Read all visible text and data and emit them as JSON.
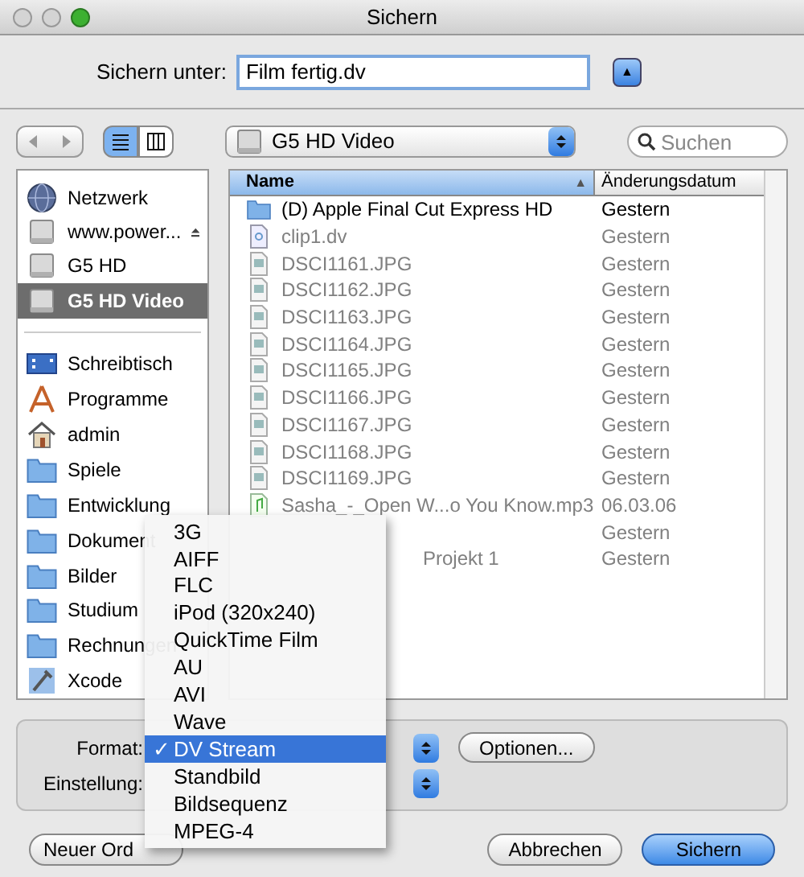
{
  "window": {
    "title": "Sichern"
  },
  "save_as": {
    "label": "Sichern unter:",
    "value": "Film fertig.dv",
    "expand_symbol": "▲"
  },
  "location": {
    "value": "G5 HD Video"
  },
  "search": {
    "placeholder": "Suchen"
  },
  "view_mode": {
    "list_selected": true
  },
  "sidebar": {
    "devices": [
      {
        "label": "Netzwerk",
        "kind": "network",
        "selected": false,
        "eject": false
      },
      {
        "label": "www.power...",
        "kind": "disk",
        "selected": false,
        "eject": true
      },
      {
        "label": "G5 HD",
        "kind": "disk",
        "selected": false,
        "eject": false
      },
      {
        "label": "G5 HD Video",
        "kind": "disk",
        "selected": true,
        "eject": false
      }
    ],
    "places": [
      {
        "label": "Schreibtisch",
        "kind": "desktop"
      },
      {
        "label": "Programme",
        "kind": "apps"
      },
      {
        "label": "admin",
        "kind": "home"
      },
      {
        "label": "Spiele",
        "kind": "folder"
      },
      {
        "label": "Entwicklung",
        "kind": "folder"
      },
      {
        "label": "Dokument",
        "kind": "folder"
      },
      {
        "label": "Bilder",
        "kind": "folder"
      },
      {
        "label": "Studium",
        "kind": "folder"
      },
      {
        "label": "Rechnungen",
        "kind": "folder"
      },
      {
        "label": "Xcode",
        "kind": "xcode"
      }
    ]
  },
  "table": {
    "columns": [
      {
        "label": "Name",
        "sort_symbol": "▲"
      },
      {
        "label": "Änderungsdatum"
      }
    ],
    "rows": [
      {
        "name": "(D) Apple Final Cut Express HD",
        "date": "Gestern",
        "kind": "folder",
        "disabled": false
      },
      {
        "name": "clip1.dv",
        "date": "Gestern",
        "kind": "movie",
        "disabled": true
      },
      {
        "name": "DSCI1161.JPG",
        "date": "Gestern",
        "kind": "image",
        "disabled": true
      },
      {
        "name": "DSCI1162.JPG",
        "date": "Gestern",
        "kind": "image",
        "disabled": true
      },
      {
        "name": "DSCI1163.JPG",
        "date": "Gestern",
        "kind": "image",
        "disabled": true
      },
      {
        "name": "DSCI1164.JPG",
        "date": "Gestern",
        "kind": "image",
        "disabled": true
      },
      {
        "name": "DSCI1165.JPG",
        "date": "Gestern",
        "kind": "image",
        "disabled": true
      },
      {
        "name": "DSCI1166.JPG",
        "date": "Gestern",
        "kind": "image",
        "disabled": true
      },
      {
        "name": "DSCI1167.JPG",
        "date": "Gestern",
        "kind": "image",
        "disabled": true
      },
      {
        "name": "DSCI1168.JPG",
        "date": "Gestern",
        "kind": "image",
        "disabled": true
      },
      {
        "name": "DSCI1169.JPG",
        "date": "Gestern",
        "kind": "image",
        "disabled": true
      },
      {
        "name": "Sasha_-_Open W...o You Know.mp3",
        "date": "06.03.06",
        "kind": "audio",
        "disabled": true
      },
      {
        "date": "Gestern",
        "kind": "hidden",
        "disabled": true
      },
      {
        "name": "Projekt 1",
        "date": "Gestern",
        "kind": "hidden",
        "disabled": true
      }
    ]
  },
  "format": {
    "label": "Format:",
    "options_button": "Optionen..."
  },
  "setting": {
    "label": "Einstellung:"
  },
  "format_menu": [
    {
      "label": "3G",
      "selected": false
    },
    {
      "label": "AIFF",
      "selected": false
    },
    {
      "label": "FLC",
      "selected": false
    },
    {
      "label": "iPod (320x240)",
      "selected": false
    },
    {
      "label": "QuickTime Film",
      "selected": false
    },
    {
      "label": "AU",
      "selected": false
    },
    {
      "label": "AVI",
      "selected": false
    },
    {
      "label": "Wave",
      "selected": false
    },
    {
      "label": "DV Stream",
      "selected": true,
      "check": "✓"
    },
    {
      "label": "Standbild",
      "selected": false
    },
    {
      "label": "Bildsequenz",
      "selected": false
    },
    {
      "label": "MPEG-4",
      "selected": false
    }
  ],
  "buttons": {
    "new_folder": "Neuer Ord",
    "cancel": "Abbrechen",
    "save": "Sichern"
  }
}
